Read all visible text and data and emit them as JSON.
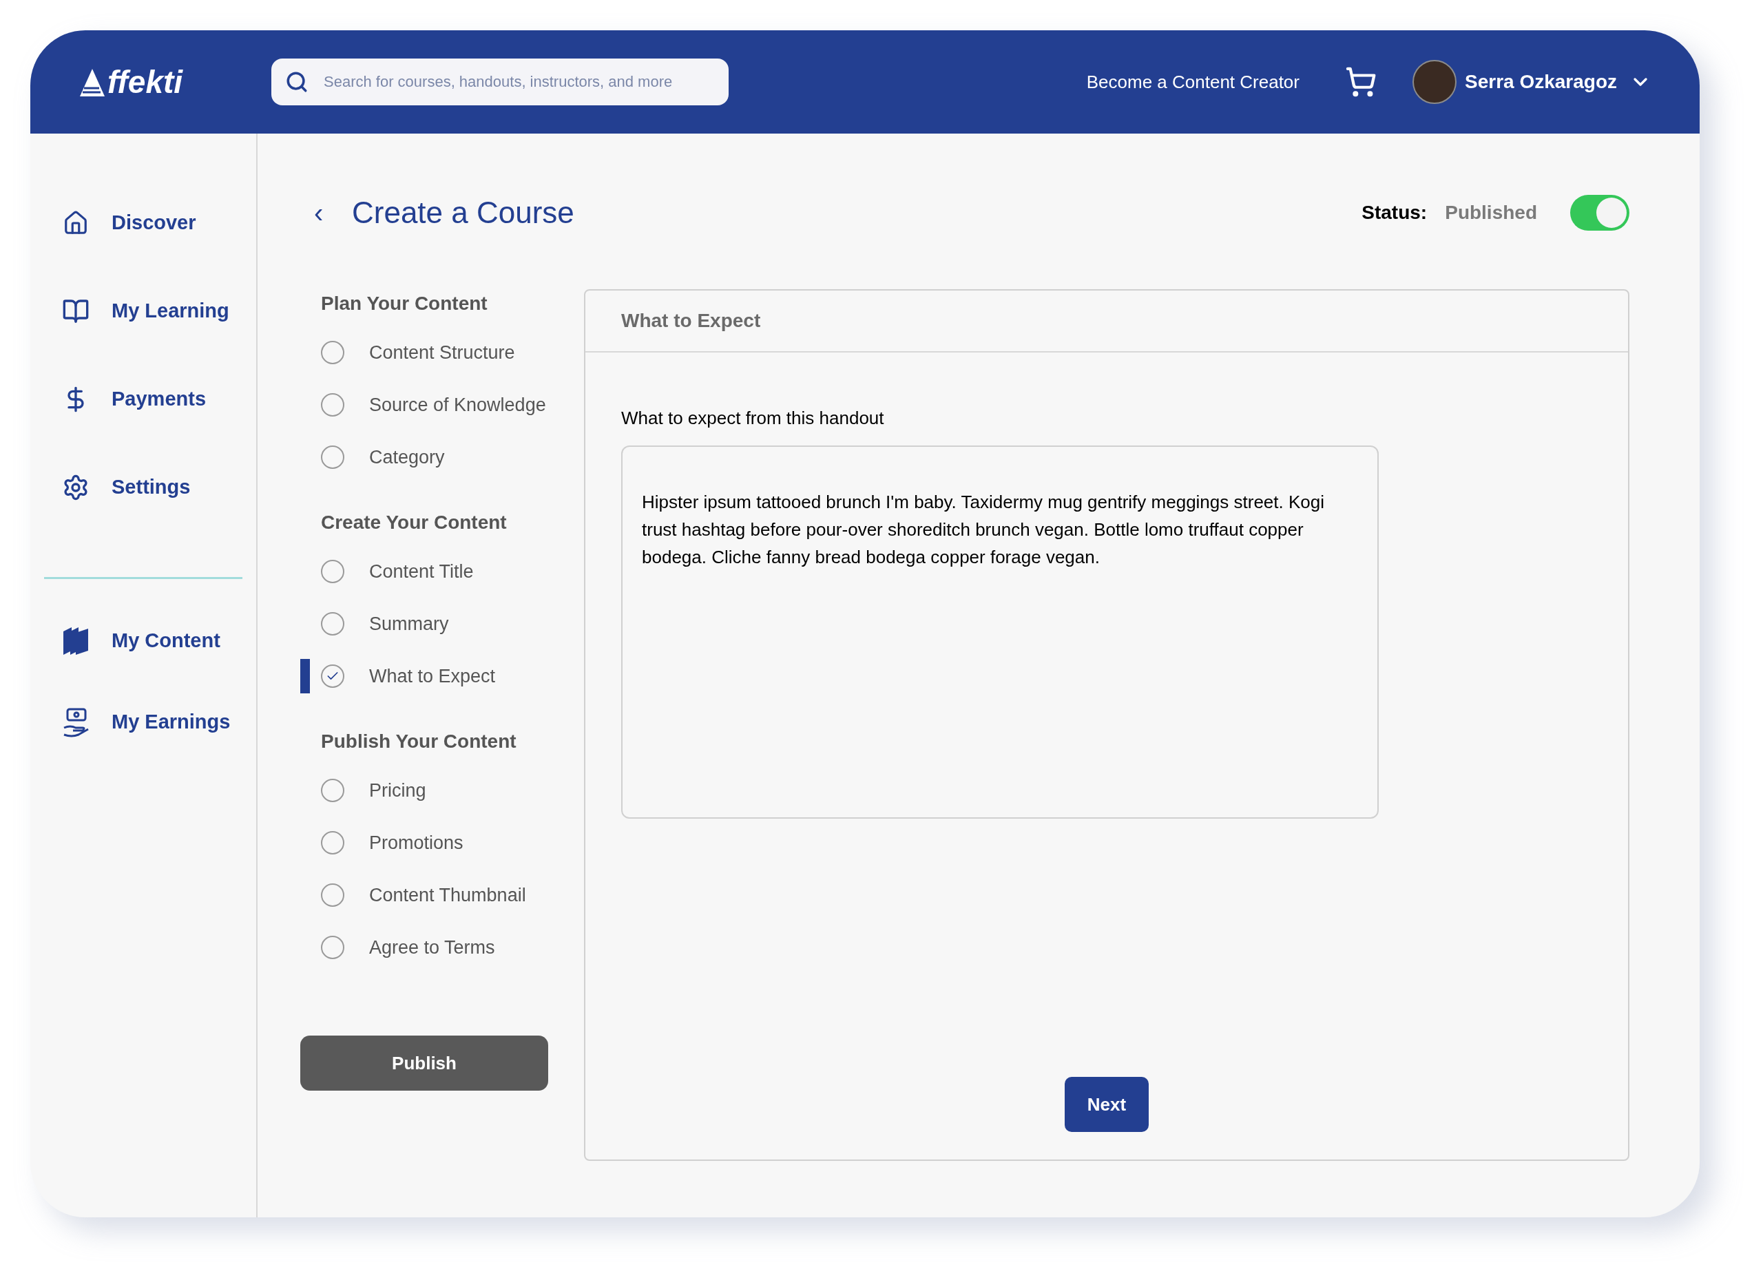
{
  "header": {
    "logo": "ffekti",
    "search": {
      "placeholder": "Search for courses, handouts, instructors, and more"
    },
    "creator_link": "Become a Content Creator",
    "user": {
      "name": "Serra Ozkaragoz"
    }
  },
  "sidebar": {
    "items": [
      {
        "label": "Discover"
      },
      {
        "label": "My Learning"
      },
      {
        "label": "Payments"
      },
      {
        "label": "Settings"
      }
    ],
    "creator_items": [
      {
        "label": "My Content"
      },
      {
        "label": "My Earnings"
      }
    ]
  },
  "page": {
    "back": "‹",
    "title": "Create a Course",
    "status_label": "Status:",
    "status_value": "Published",
    "status_on": true
  },
  "steps": [
    {
      "title": "Plan Your Content",
      "items": [
        {
          "label": "Content Structure",
          "checked": false,
          "selected": false
        },
        {
          "label": "Source of Knowledge",
          "checked": false,
          "selected": false
        },
        {
          "label": "Category",
          "checked": false,
          "selected": false
        }
      ]
    },
    {
      "title": "Create Your Content",
      "items": [
        {
          "label": "Content Title",
          "checked": false,
          "selected": false
        },
        {
          "label": "Summary",
          "checked": false,
          "selected": false
        },
        {
          "label": "What to Expect",
          "checked": true,
          "selected": true
        }
      ]
    },
    {
      "title": "Publish Your Content",
      "items": [
        {
          "label": "Pricing",
          "checked": false,
          "selected": false
        },
        {
          "label": "Promotions",
          "checked": false,
          "selected": false
        },
        {
          "label": "Content Thumbnail",
          "checked": false,
          "selected": false
        },
        {
          "label": "Agree to Terms",
          "checked": false,
          "selected": false
        }
      ]
    }
  ],
  "publish_button": "Publish",
  "panel": {
    "title": "What to Expect",
    "field_label": "What to expect from this handout",
    "value": "Hipster ipsum tattooed brunch I'm baby. Taxidermy mug gentrify meggings street. Kogi trust hashtag before pour-over shoreditch brunch vegan. Bottle lomo truffaut copper bodega. Cliche fanny bread bodega copper forage vegan.",
    "next_button": "Next"
  }
}
